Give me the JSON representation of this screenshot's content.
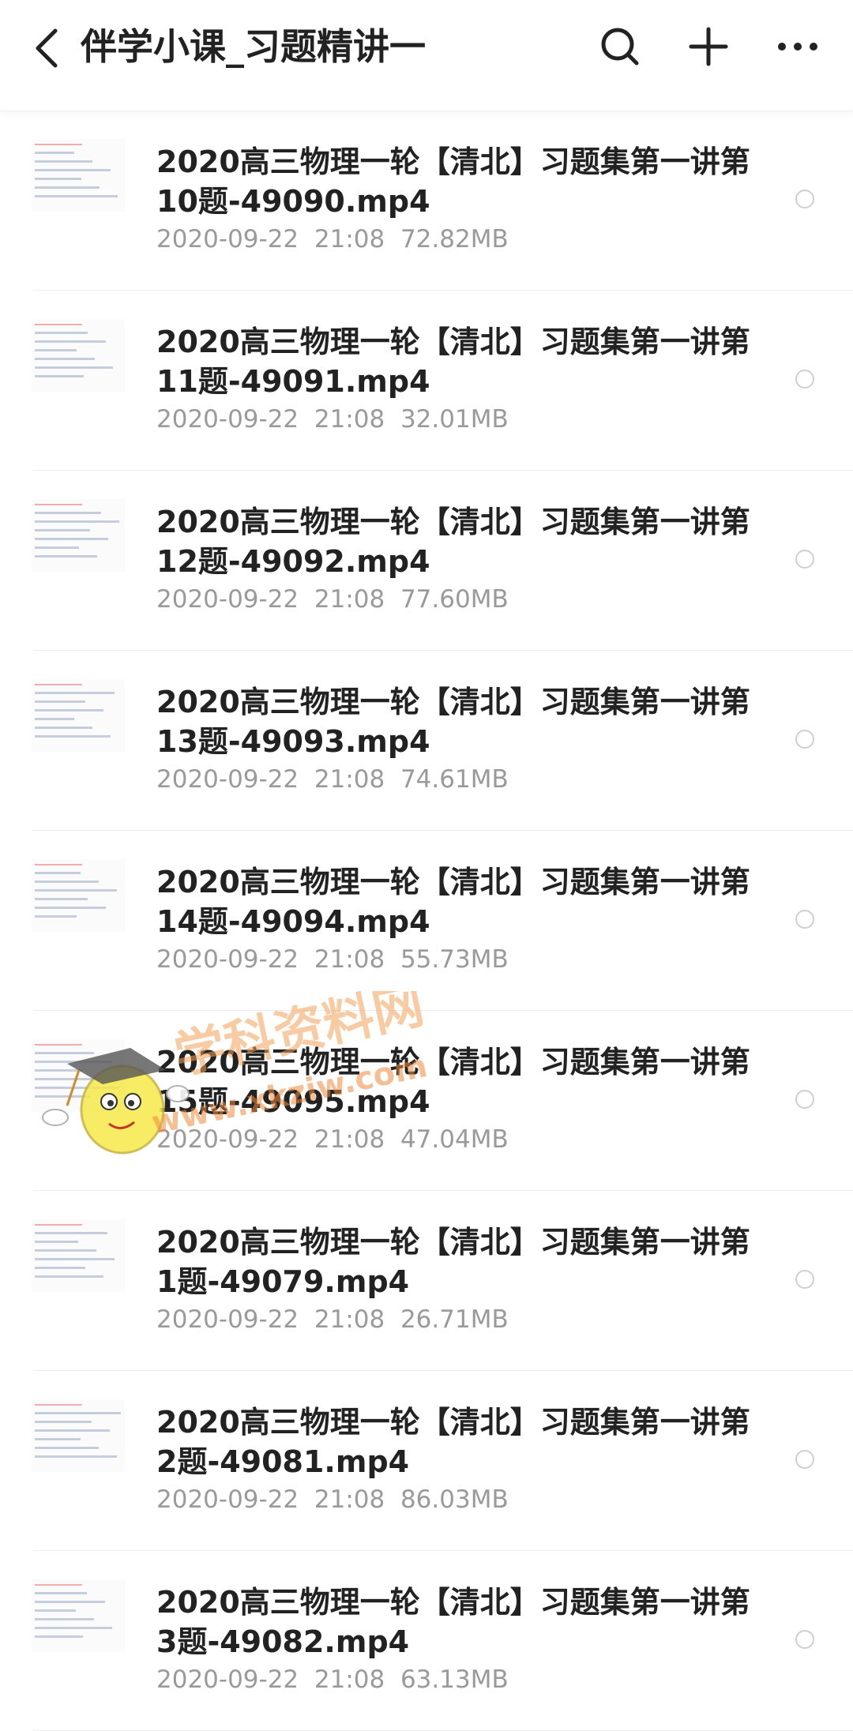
{
  "header": {
    "title": "伴学小课_习题精讲一",
    "back_icon": "chevron-left",
    "search_icon": "search",
    "add_icon": "plus",
    "more_icon": "more-horizontal"
  },
  "files": [
    {
      "name": "2020高三物理一轮【清北】习题集第一讲第10题-49090.mp4",
      "date": "2020-09-22",
      "time": "21:08",
      "size": "72.82MB"
    },
    {
      "name": "2020高三物理一轮【清北】习题集第一讲第11题-49091.mp4",
      "date": "2020-09-22",
      "time": "21:08",
      "size": "32.01MB"
    },
    {
      "name": "2020高三物理一轮【清北】习题集第一讲第12题-49092.mp4",
      "date": "2020-09-22",
      "time": "21:08",
      "size": "77.60MB"
    },
    {
      "name": "2020高三物理一轮【清北】习题集第一讲第13题-49093.mp4",
      "date": "2020-09-22",
      "time": "21:08",
      "size": "74.61MB"
    },
    {
      "name": "2020高三物理一轮【清北】习题集第一讲第14题-49094.mp4",
      "date": "2020-09-22",
      "time": "21:08",
      "size": "55.73MB"
    },
    {
      "name": "2020高三物理一轮【清北】习题集第一讲第15题-49095.mp4",
      "date": "2020-09-22",
      "time": "21:08",
      "size": "47.04MB"
    },
    {
      "name": "2020高三物理一轮【清北】习题集第一讲第1题-49079.mp4",
      "date": "2020-09-22",
      "time": "21:08",
      "size": "26.71MB"
    },
    {
      "name": "2020高三物理一轮【清北】习题集第一讲第2题-49081.mp4",
      "date": "2020-09-22",
      "time": "21:08",
      "size": "86.03MB"
    },
    {
      "name": "2020高三物理一轮【清北】习题集第一讲第3题-49082.mp4",
      "date": "2020-09-22",
      "time": "21:08",
      "size": "63.13MB"
    }
  ],
  "watermark": {
    "text": "学科资料网",
    "url": "www.xkziw.com"
  },
  "colors": {
    "title": "#222222",
    "meta": "#9a9a9a",
    "separator": "#ececec",
    "radio": "#cfcfcf"
  }
}
